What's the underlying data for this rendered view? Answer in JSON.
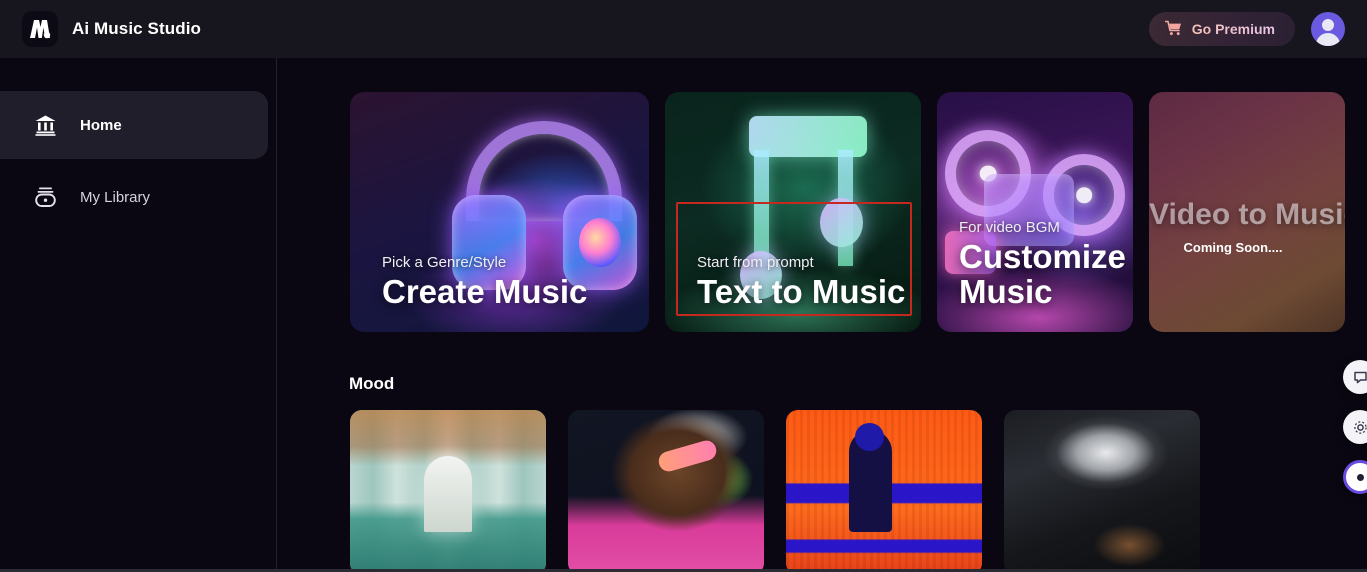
{
  "header": {
    "brand_name": "Ai Music Studio",
    "logo_icon": "m-note-logo-icon",
    "premium_label": "Go Premium",
    "premium_icon": "shopping-cart-icon",
    "avatar_icon": "user-avatar-icon"
  },
  "sidebar": {
    "items": [
      {
        "label": "Home",
        "icon": "bank-building-icon",
        "active": true
      },
      {
        "label": "My Library",
        "icon": "library-disc-icon",
        "active": false
      }
    ]
  },
  "main": {
    "feature_cards": [
      {
        "kicker": "Pick a Genre/Style",
        "title": "Create Music",
        "art": "headphones"
      },
      {
        "kicker": "Start from prompt",
        "title": "Text to Music",
        "art": "music-note"
      },
      {
        "kicker": "For video BGM",
        "title": "Customize Music",
        "art": "film-projector"
      },
      {
        "title": "Video to Music",
        "subtitle": "Coming Soon....",
        "art": "gradient",
        "disabled": true
      }
    ],
    "mood": {
      "section_title": "Mood",
      "cards": [
        {
          "art": "flooded-palace-statue"
        },
        {
          "art": "laughing-man-green-headphones"
        },
        {
          "art": "orange-blue-seated-silhouette"
        },
        {
          "art": "dark-stormy-canyon"
        }
      ]
    }
  },
  "floating_widgets": [
    {
      "icon": "chat-bubble-icon",
      "label": ""
    },
    {
      "icon": "settings-gear-icon",
      "label": ""
    },
    {
      "icon": "assistant-circle-icon",
      "label": ""
    }
  ],
  "annotation": {
    "type": "highlight-rectangle",
    "color": "#c4281e",
    "targets": "Text to Music"
  },
  "colors": {
    "header_bg": "#17151d",
    "page_bg": "#0a0712",
    "sidebar_active_bg": "#211e2c",
    "accent": "#6a5ae0",
    "annotation": "#c4281e"
  }
}
